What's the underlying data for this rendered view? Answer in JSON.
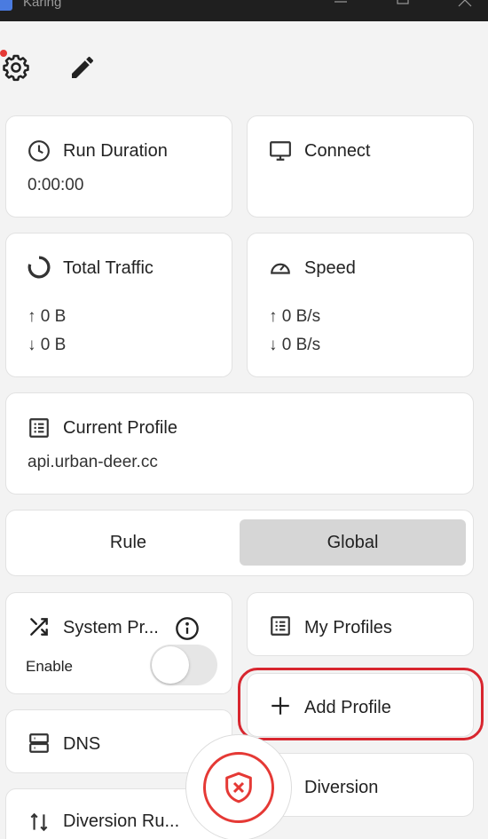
{
  "window": {
    "title": "Karing"
  },
  "cards": {
    "run_duration": {
      "title": "Run Duration",
      "value": "0:00:00"
    },
    "connect": {
      "title": "Connect"
    },
    "total_traffic": {
      "title": "Total Traffic",
      "up": "↑ 0 B",
      "down": "↓ 0 B"
    },
    "speed": {
      "title": "Speed",
      "up": "↑ 0 B/s",
      "down": "↓ 0 B/s"
    },
    "current_profile": {
      "title": "Current Profile",
      "value": "api.urban-deer.cc"
    },
    "mode": {
      "rule": "Rule",
      "global": "Global",
      "selected": "Global"
    },
    "system_proxy": {
      "title": "System Pr...",
      "enable_label": "Enable",
      "enabled": false
    },
    "my_profiles": {
      "title": "My Profiles"
    },
    "add_profile": {
      "title": "Add Profile"
    },
    "dns": {
      "title": "DNS"
    },
    "diversion": {
      "title": "Diversion"
    },
    "diversion_rules": {
      "title": "Diversion Ru..."
    }
  },
  "colors": {
    "accent": "#d8262f",
    "fab": "#e53935",
    "toggle_off": "#e6e6e6"
  },
  "icons": [
    "gear-icon",
    "pencil-icon",
    "clock-icon",
    "monitor-icon",
    "donut-icon",
    "gauge-icon",
    "list-icon",
    "shuffle-icon",
    "info-icon",
    "plus-icon",
    "server-icon",
    "shield-x-icon"
  ]
}
